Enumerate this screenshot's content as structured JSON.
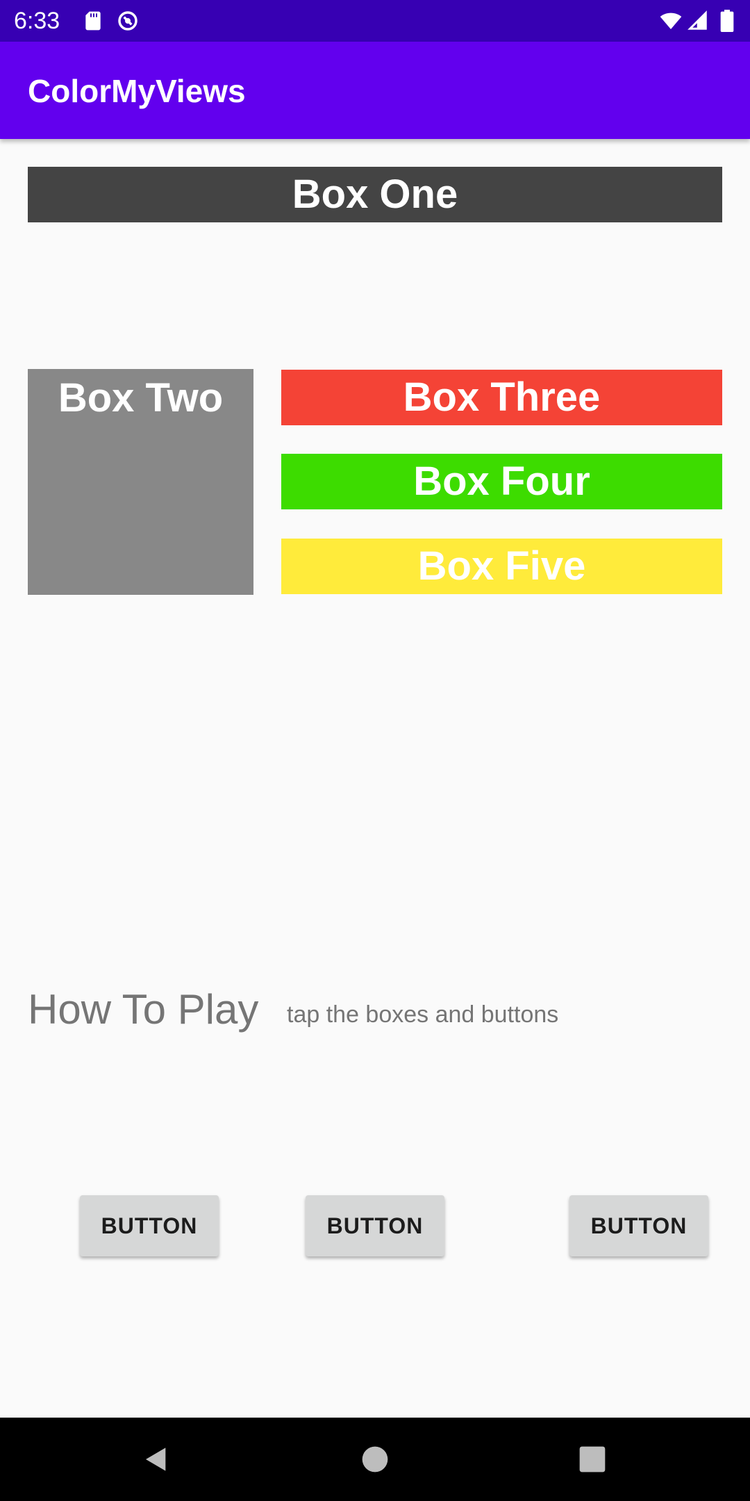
{
  "status_bar": {
    "time": "6:33",
    "icons": [
      "sd-card-icon",
      "sync-icon",
      "wifi-icon",
      "signal-icon",
      "battery-icon"
    ]
  },
  "app_bar": {
    "title": "ColorMyViews"
  },
  "boxes": {
    "one": {
      "label": "Box One",
      "color": "#444444"
    },
    "two": {
      "label": "Box Two",
      "color": "#888888"
    },
    "three": {
      "label": "Box Three",
      "color": "#F44336"
    },
    "four": {
      "label": "Box Four",
      "color": "#3DDC00"
    },
    "five": {
      "label": "Box Five",
      "color": "#FFEB3B"
    }
  },
  "instructions": {
    "label": "How To Play",
    "text": "tap the boxes and buttons"
  },
  "buttons": [
    {
      "label": "BUTTON"
    },
    {
      "label": "BUTTON"
    },
    {
      "label": "BUTTON"
    }
  ],
  "colors": {
    "status_bar": "#3700B3",
    "app_bar": "#6200EE",
    "background": "#FAFAFA",
    "button": "#D6D7D7"
  },
  "nav_bar": {
    "icons": [
      "back-icon",
      "home-icon",
      "recents-icon"
    ]
  }
}
